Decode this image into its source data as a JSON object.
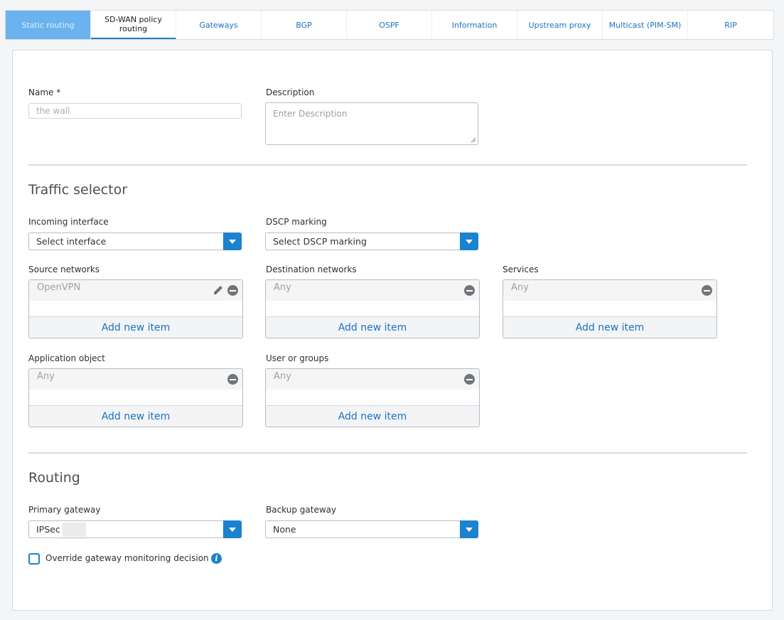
{
  "tabs": [
    {
      "label": "Static routing",
      "state": "disabled"
    },
    {
      "label": "SD-WAN policy routing",
      "state": "active"
    },
    {
      "label": "Gateways",
      "state": "normal"
    },
    {
      "label": "BGP",
      "state": "normal"
    },
    {
      "label": "OSPF",
      "state": "normal"
    },
    {
      "label": "Information",
      "state": "normal"
    },
    {
      "label": "Upstream proxy",
      "state": "normal"
    },
    {
      "label": "Multicast (PIM-SM)",
      "state": "normal"
    },
    {
      "label": "RIP",
      "state": "normal"
    }
  ],
  "form": {
    "name_label": "Name *",
    "name_value": "the wall",
    "description_label": "Description",
    "description_placeholder": "Enter Description"
  },
  "traffic_selector": {
    "title": "Traffic selector",
    "incoming_interface_label": "Incoming interface",
    "incoming_interface_value": "Select interface",
    "dscp_label": "DSCP marking",
    "dscp_value": "Select DSCP marking",
    "source_networks": {
      "label": "Source networks",
      "item": "OpenVPN",
      "add": "Add new item"
    },
    "destination_networks": {
      "label": "Destination networks",
      "item": "Any",
      "add": "Add new item"
    },
    "services": {
      "label": "Services",
      "item": "Any",
      "add": "Add new item"
    },
    "application_object": {
      "label": "Application object",
      "item": "Any",
      "add": "Add new item"
    },
    "user_or_groups": {
      "label": "User or groups",
      "item": "Any",
      "add": "Add new item"
    }
  },
  "routing": {
    "title": "Routing",
    "primary_gateway_label": "Primary gateway",
    "primary_gateway_value": "IPSec",
    "backup_gateway_label": "Backup gateway",
    "backup_gateway_value": "None",
    "override_label": "Override gateway monitoring decision",
    "override_checked": false
  },
  "colors": {
    "accent": "#1a82cf",
    "link": "#1a73c4",
    "tab_disabled_bg": "#6ab3ee"
  },
  "icons": {
    "dropdown": "chevron-down-icon",
    "remove": "minus-circle-icon",
    "edit": "pencil-icon",
    "info": "info-icon"
  }
}
